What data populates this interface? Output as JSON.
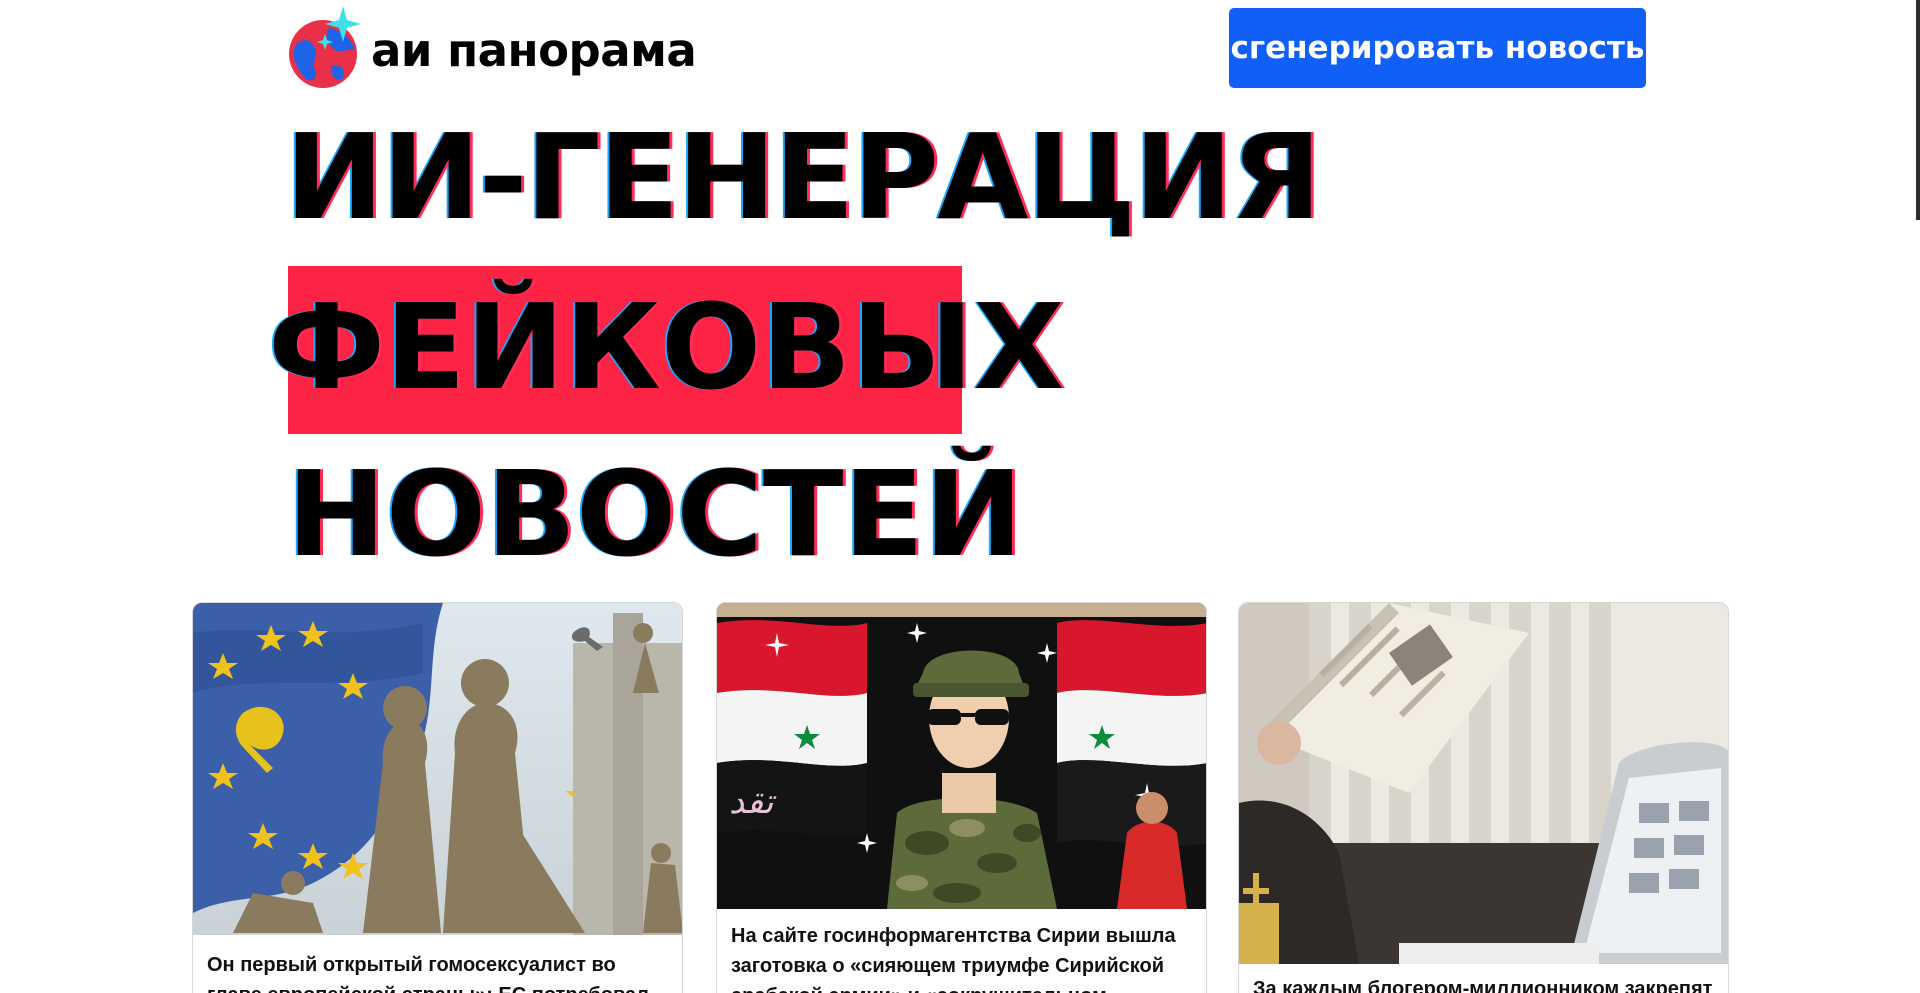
{
  "header": {
    "logo_text": "аи панорама",
    "logo_icon": "globe-sparkle-icon",
    "generate_button_label": "сгенерировать новость"
  },
  "hero": {
    "line1": "ИИ-ГЕНЕРАЦИЯ",
    "line2": "ФЕЙКОВЫХ",
    "line3": "НОВОСТЕЙ"
  },
  "articles": [
    {
      "title": "Он первый открытый гомосексуалист во главе европейской страны»: ЕС потребовал от",
      "image": "eu-flag-statues-illustration"
    },
    {
      "title": "На сайте госинформагентства Сирии вышла заготовка о «сияющем триумфе Сирийской арабской армии» и «сокрушительном",
      "image": "syrian-soldier-poster-photo"
    },
    {
      "title": "За каждым блогером-миллионником закрепят",
      "image": "priest-reading-newspaper-photo"
    }
  ],
  "colors": {
    "brand_blue": "#1060f8",
    "highlight_red": "#fc2344"
  }
}
